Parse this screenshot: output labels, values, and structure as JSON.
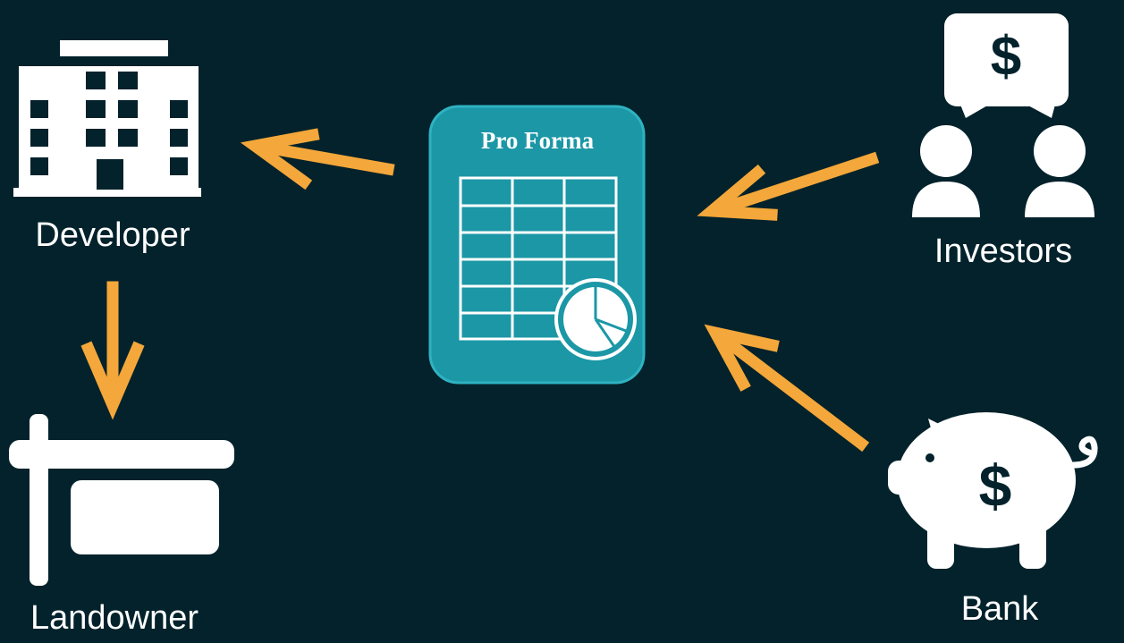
{
  "nodes": {
    "developer": {
      "label": "Developer",
      "icon": "office-building-icon"
    },
    "landowner": {
      "label": "Landowner",
      "icon": "for-sale-sign-icon"
    },
    "investors": {
      "label": "Investors",
      "icon": "investors-speech-bubble-icon"
    },
    "bank": {
      "label": "Bank",
      "icon": "piggy-bank-icon"
    },
    "pro_forma": {
      "title": "Pro Forma",
      "icon": "spreadsheet-pie-chart-icon"
    }
  },
  "edges": [
    {
      "from": "pro_forma",
      "to": "developer"
    },
    {
      "from": "developer",
      "to": "landowner"
    },
    {
      "from": "investors",
      "to": "pro_forma"
    },
    {
      "from": "bank",
      "to": "pro_forma"
    }
  ],
  "colors": {
    "background": "#03222b",
    "arrow": "#f4a73a",
    "icon": "#ffffff",
    "pro_forma_card": "#1b97a6",
    "pro_forma_border": "#2fb2c2",
    "dollar": "#03222b"
  }
}
